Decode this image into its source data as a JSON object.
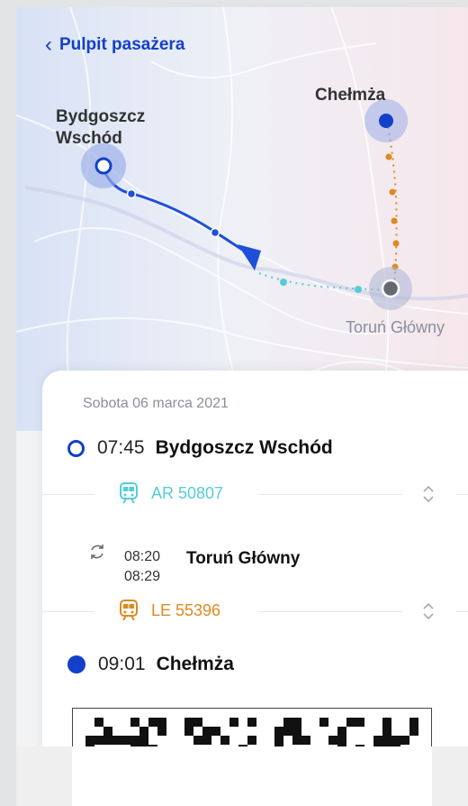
{
  "nav": {
    "back_label": "Pulpit pasażera",
    "back_icon": "chevron-left-icon"
  },
  "map": {
    "labels": {
      "origin": "Bydgoszcz Wschód",
      "destination": "Chełmża",
      "transfer": "Toruń Główny"
    },
    "colors": {
      "route_main": "#1d4fd8",
      "route_teal": "#55ccd8",
      "route_orange": "#dd8a1f",
      "origin_marker": "#1240c8",
      "transfer_marker": "#666a70"
    }
  },
  "journey": {
    "date": "Sobota 06 marca 2021",
    "origin": {
      "time": "07:45",
      "name": "Bydgoszcz Wschód"
    },
    "train1": {
      "number": "AR 50807",
      "color": "#55ccd8",
      "icon": "train-icon"
    },
    "transfer": {
      "arrival": "08:20",
      "departure": "08:29",
      "name": "Toruń Główny",
      "icon": "transfer-icon"
    },
    "train2": {
      "number": "LE 55396",
      "color": "#dd8a1f",
      "icon": "train-icon"
    },
    "destination": {
      "time": "09:01",
      "name": "Chełmża"
    }
  },
  "ticket": {
    "code_icon": "qr-code-icon"
  }
}
